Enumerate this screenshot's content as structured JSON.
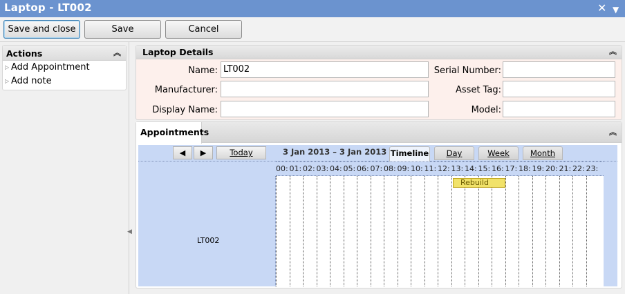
{
  "window": {
    "title": "Laptop - LT002",
    "pin_icon": "pin-icon",
    "close_icon": "close-icon"
  },
  "toolbar": {
    "save_close": "Save and close",
    "save": "Save",
    "cancel": "Cancel"
  },
  "actions": {
    "title": "Actions",
    "items": [
      {
        "label": "Add Appointment"
      },
      {
        "label": "Add note"
      }
    ]
  },
  "details": {
    "title": "Laptop Details",
    "fields": {
      "name": {
        "label": "Name:",
        "value": "LT002"
      },
      "manufacturer": {
        "label": "Manufacturer:",
        "value": ""
      },
      "display_name": {
        "label": "Display Name:",
        "value": ""
      },
      "serial_number": {
        "label": "Serial Number:",
        "value": ""
      },
      "asset_tag": {
        "label": "Asset Tag:",
        "value": ""
      },
      "model": {
        "label": "Model:",
        "value": ""
      }
    }
  },
  "appointments": {
    "tab_label": "Appointments",
    "scheduler": {
      "prev": "◀",
      "next": "▶",
      "today": "Today",
      "date_range": "3 Jan 2013 – 3 Jan 2013",
      "views": [
        "Timeline",
        "Day",
        "Week",
        "Month"
      ],
      "active_view": "Timeline",
      "hours": [
        "00:",
        "01:",
        "02:",
        "03:",
        "04:",
        "05:",
        "06:",
        "07:",
        "08:",
        "09:",
        "10:",
        "11:",
        "12:",
        "13:",
        "14:",
        "15:",
        "16:",
        "17:",
        "18:",
        "19:",
        "20:",
        "21:",
        "22:",
        "23:"
      ],
      "resource": "LT002",
      "event": {
        "title": "Rebuild"
      }
    }
  },
  "colors": {
    "titlebar": "#6b93cf",
    "scheduler_bg": "#c8d8f5",
    "event": "#f1e26a"
  }
}
